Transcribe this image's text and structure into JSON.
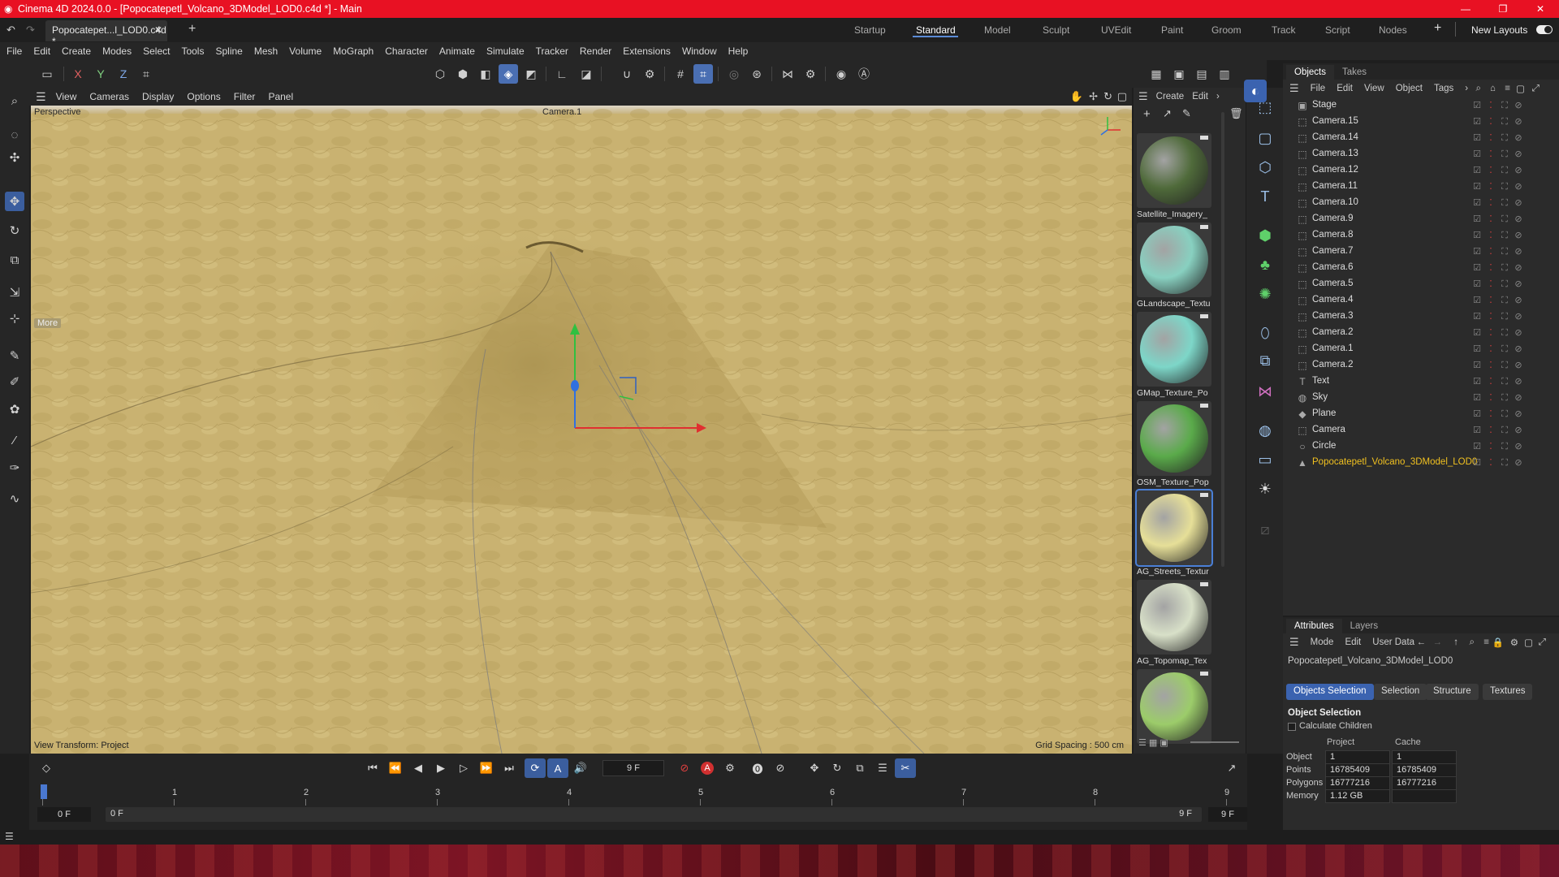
{
  "window": {
    "title": "Cinema 4D 2024.0.0 - [Popocatepetl_Volcano_3DModel_LOD0.c4d *] - Main",
    "minimize": "—",
    "maximize": "❐",
    "close": "✕"
  },
  "doc_tab": "Popocatepet...l_LOD0.c4d *",
  "layouts": {
    "items": [
      "Startup",
      "Standard",
      "Model",
      "Sculpt",
      "UVEdit",
      "Paint",
      "Groom",
      "Track",
      "Script",
      "Nodes"
    ],
    "active": "Standard",
    "new_layouts": "New Layouts"
  },
  "menu": [
    "File",
    "Edit",
    "Create",
    "Modes",
    "Select",
    "Tools",
    "Spline",
    "Mesh",
    "Volume",
    "MoGraph",
    "Character",
    "Animate",
    "Simulate",
    "Tracker",
    "Render",
    "Extensions",
    "Window",
    "Help"
  ],
  "axis_buttons": {
    "x": "X",
    "y": "Y",
    "z": "Z"
  },
  "viewport": {
    "menu": [
      "View",
      "Cameras",
      "Display",
      "Options",
      "Filter",
      "Panel"
    ],
    "projection": "Perspective",
    "camera": "Camera.1",
    "more": "More",
    "view_transform": "View Transform: Project",
    "grid_spacing": "Grid Spacing : 500 cm"
  },
  "materials": {
    "menu": [
      "Create",
      "Edit"
    ],
    "items": [
      {
        "name": "Satellite_Imagery_",
        "color": "#4f6a3a"
      },
      {
        "name": "GLandscape_Textu",
        "color": "#88d0c0"
      },
      {
        "name": "GMap_Texture_Po",
        "color": "#7dd6c8"
      },
      {
        "name": "OSM_Texture_Pop",
        "color": "#5aaa4a"
      },
      {
        "name": "AG_Streets_Textur",
        "color": "#e6df98"
      },
      {
        "name": "AG_Topomap_Tex",
        "color": "#d8e0c8"
      },
      {
        "name": "",
        "color": "#9ccc6a"
      }
    ]
  },
  "objects": {
    "tabs": [
      "Objects",
      "Takes"
    ],
    "menu": [
      "File",
      "Edit",
      "View",
      "Object",
      "Tags"
    ],
    "rows": [
      {
        "name": "Stage",
        "icon": "stage-icon",
        "glyph": "▣"
      },
      {
        "name": "Camera.15",
        "icon": "camera-icon",
        "glyph": "⬚"
      },
      {
        "name": "Camera.14",
        "icon": "camera-icon",
        "glyph": "⬚"
      },
      {
        "name": "Camera.13",
        "icon": "camera-icon",
        "glyph": "⬚"
      },
      {
        "name": "Camera.12",
        "icon": "camera-icon",
        "glyph": "⬚"
      },
      {
        "name": "Camera.11",
        "icon": "camera-icon",
        "glyph": "⬚"
      },
      {
        "name": "Camera.10",
        "icon": "camera-icon",
        "glyph": "⬚"
      },
      {
        "name": "Camera.9",
        "icon": "camera-icon",
        "glyph": "⬚"
      },
      {
        "name": "Camera.8",
        "icon": "camera-icon",
        "glyph": "⬚"
      },
      {
        "name": "Camera.7",
        "icon": "camera-icon",
        "glyph": "⬚"
      },
      {
        "name": "Camera.6",
        "icon": "camera-icon",
        "glyph": "⬚"
      },
      {
        "name": "Camera.5",
        "icon": "camera-icon",
        "glyph": "⬚"
      },
      {
        "name": "Camera.4",
        "icon": "camera-icon",
        "glyph": "⬚"
      },
      {
        "name": "Camera.3",
        "icon": "camera-icon",
        "glyph": "⬚"
      },
      {
        "name": "Camera.2",
        "icon": "camera-icon",
        "glyph": "⬚"
      },
      {
        "name": "Camera.1",
        "icon": "camera-icon",
        "glyph": "⬚"
      },
      {
        "name": "Camera.2",
        "icon": "camera-icon",
        "glyph": "⬚"
      },
      {
        "name": "Text",
        "icon": "text-icon",
        "glyph": "T"
      },
      {
        "name": "Sky",
        "icon": "sky-icon",
        "glyph": "◍"
      },
      {
        "name": "Plane",
        "icon": "plane-icon",
        "glyph": "◆"
      },
      {
        "name": "Camera",
        "icon": "camera-icon",
        "glyph": "⬚"
      },
      {
        "name": "Circle",
        "icon": "circle-icon",
        "glyph": "○"
      },
      {
        "name": "Popocatepetl_Volcano_3DModel_LOD0",
        "icon": "mesh-icon",
        "glyph": "▲"
      }
    ],
    "selected_color": "#f0c020"
  },
  "attributes": {
    "tabs": [
      "Attributes",
      "Layers"
    ],
    "menu": [
      "Mode",
      "Edit",
      "User Data"
    ],
    "object_name": "Popocatepetl_Volcano_3DModel_LOD0",
    "sub_tabs": [
      "Objects Selection",
      "Selection",
      "Structure",
      "Textures"
    ],
    "section": "Object Selection",
    "calculate_children": "Calculate Children",
    "col_project": "Project",
    "col_cache": "Cache",
    "rows": [
      {
        "label": "Object",
        "project": "1",
        "cache": "1"
      },
      {
        "label": "Points",
        "project": "16785409",
        "cache": "16785409"
      },
      {
        "label": "Polygons",
        "project": "16777216",
        "cache": "16777216"
      },
      {
        "label": "Memory",
        "project": "1.12 GB",
        "cache": ""
      }
    ]
  },
  "timeline": {
    "frame": "9 F",
    "start": "0 F",
    "range_start": "0 F",
    "range_end": "9 F",
    "end": "9 F",
    "ticks": [
      "0",
      "1",
      "2",
      "3",
      "4",
      "5",
      "6",
      "7",
      "8",
      "9"
    ]
  }
}
